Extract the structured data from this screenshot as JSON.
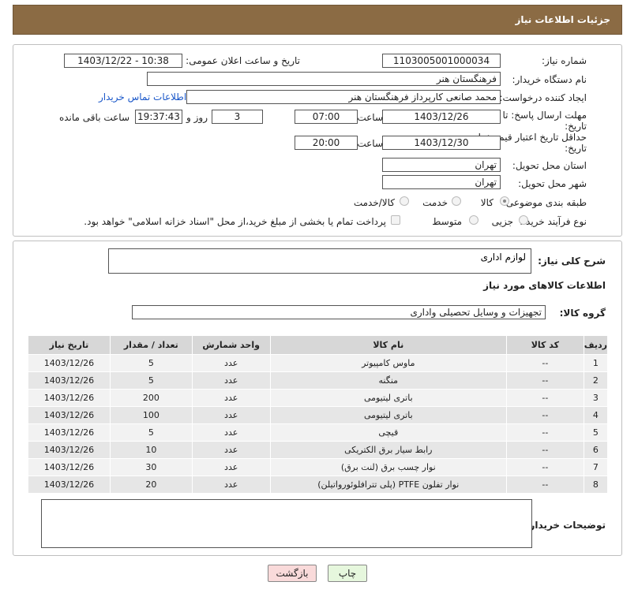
{
  "header": {
    "title": "جزئیات اطلاعات نیاز"
  },
  "form": {
    "need_number": {
      "label": "شماره نیاز:",
      "value": "1103005001000034"
    },
    "announce_datetime": {
      "label": "تاریخ و ساعت اعلان عمومی:",
      "value": "1403/12/22 - 10:38"
    },
    "buyer_org": {
      "label": "نام دستگاه خریدار:",
      "value": "فرهنگستان هنر"
    },
    "requester": {
      "label": "ایجاد کننده درخواست:",
      "value": "محمد صانعی کارپرداز فرهنگستان هنر"
    },
    "contact_link": "اطلاعات تماس خریدار",
    "reply_deadline": {
      "label_line1": "مهلت ارسال پاسخ: تا",
      "label_line2": "تاریخ:",
      "date": "1403/12/26",
      "time_label": "ساعت",
      "time": "07:00",
      "days": "3",
      "days_label": "روز و",
      "remaining": "19:37:43",
      "remaining_label": "ساعت باقی مانده"
    },
    "price_validity": {
      "label_line1": "حداقل تاریخ اعتبار قیمت: تا",
      "label_line2": "تاریخ:",
      "date": "1403/12/30",
      "time_label": "ساعت",
      "time": "20:00"
    },
    "delivery_province": {
      "label": "استان محل تحویل:",
      "value": "تهران"
    },
    "delivery_city": {
      "label": "شهر محل تحویل:",
      "value": "تهران"
    },
    "category": {
      "label": "طبقه بندی موضوعی:",
      "options": [
        "کالا",
        "خدمت",
        "کالا/خدمت"
      ],
      "selected": "کالا"
    },
    "purchase_type": {
      "label": "نوع فرآیند خرید :",
      "options": [
        "جزیی",
        "متوسط"
      ],
      "note": "پرداخت تمام یا بخشی از مبلغ خرید،از محل \"اسناد خزانه اسلامی\" خواهد بود."
    }
  },
  "details": {
    "general_desc_label": "شرح کلی نیاز:",
    "general_desc_value": "لوازم اداری",
    "items_heading": "اطلاعات کالاهای مورد نیاز",
    "group_label": "گروه کالا:",
    "group_value": "تجهیزات و وسایل تحصیلی واداری",
    "table": {
      "headers": [
        "ردیف",
        "کد کالا",
        "نام کالا",
        "واحد شمارش",
        "تعداد / مقدار",
        "تاریخ نیاز"
      ],
      "rows": [
        [
          "1",
          "--",
          "ماوس کامپیوتر",
          "عدد",
          "5",
          "1403/12/26"
        ],
        [
          "2",
          "--",
          "منگنه",
          "عدد",
          "5",
          "1403/12/26"
        ],
        [
          "3",
          "--",
          "باتری لیتیومی",
          "عدد",
          "200",
          "1403/12/26"
        ],
        [
          "4",
          "--",
          "باتری لیتیومی",
          "عدد",
          "100",
          "1403/12/26"
        ],
        [
          "5",
          "--",
          "قیچی",
          "عدد",
          "5",
          "1403/12/26"
        ],
        [
          "6",
          "--",
          "رابط سیار برق الکتریکی",
          "عدد",
          "10",
          "1403/12/26"
        ],
        [
          "7",
          "--",
          "نوار چسب برق (لنت برق)",
          "عدد",
          "30",
          "1403/12/26"
        ],
        [
          "8",
          "--",
          "نوار تفلون PTFE (پلی تترافلوئورواتیلن)",
          "عدد",
          "20",
          "1403/12/26"
        ]
      ]
    },
    "buyer_notes_label": "توضیحات خریدار:",
    "buyer_notes_value": ""
  },
  "buttons": {
    "print": "چاپ",
    "back": "بازگشت"
  },
  "colors": {
    "header_bg": "#8b6b44",
    "link": "#1a57c9",
    "print_btn": "#e6f7dd",
    "back_btn": "#f9dada"
  }
}
